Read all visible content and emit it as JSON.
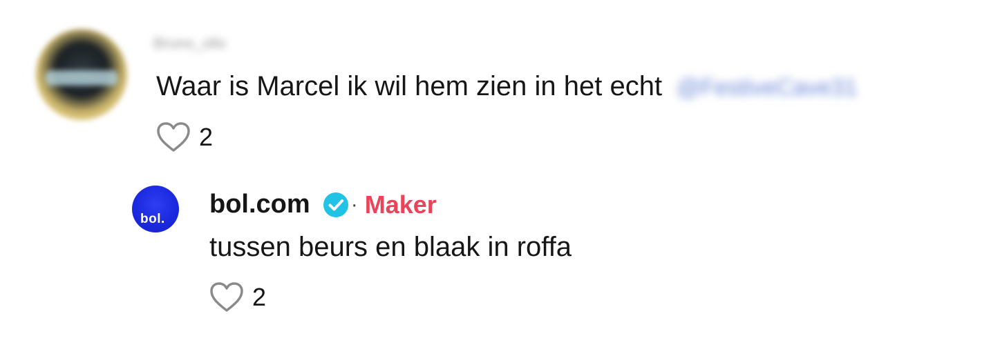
{
  "comment": {
    "username": "Bruno_ollo",
    "text": "Waar is Marcel ik wil hem zien in het echt",
    "mention": "@FestiveCave31",
    "likes": "2",
    "avatar_icon": "user-avatar-blurred"
  },
  "reply": {
    "username": "bol.com",
    "verified_icon": "verified-badge-icon",
    "separator": "·",
    "role_label": "Maker",
    "text": "tussen beurs en blaak in roffa",
    "likes": "2",
    "avatar_logo_text": "bol.",
    "avatar_icon": "bol-logo-avatar"
  },
  "colors": {
    "maker": "#e8455a",
    "verified": "#20c3e6",
    "text": "#161616",
    "bol_blue": "#1b2adf"
  }
}
